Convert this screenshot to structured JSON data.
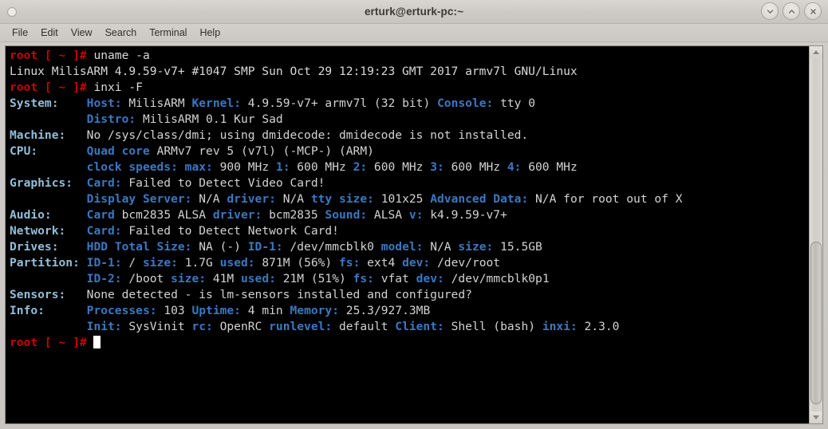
{
  "window": {
    "title": "erturk@erturk-pc:~",
    "icon": "terminal-window-icon",
    "controls": {
      "minimize": "chevron-down-icon",
      "maximize": "chevron-up-icon",
      "close": "close-icon"
    }
  },
  "menubar": {
    "items": [
      {
        "label": "File"
      },
      {
        "label": "Edit"
      },
      {
        "label": "View"
      },
      {
        "label": "Search"
      },
      {
        "label": "Terminal"
      },
      {
        "label": "Help"
      }
    ]
  },
  "scrollbar": {
    "up_icon": "triangle-up-icon",
    "down_icon": "triangle-down-icon",
    "thumb_top_percent": 52,
    "thumb_height_percent": 46
  },
  "terminal": {
    "prompt": "root [ ~ ]# ",
    "commands": [
      "uname -a",
      "inxi -F"
    ],
    "uname_output": "Linux MilisARM 4.9.59-v7+ #1047 SMP Sun Oct 29 12:19:23 GMT 2017 armv7l GNU/Linux",
    "inxi": [
      {
        "section": "System:",
        "lines": [
          [
            {
              "t": "label",
              "v": "Host:"
            },
            {
              "t": "value",
              "v": " MilisARM "
            },
            {
              "t": "label",
              "v": "Kernel:"
            },
            {
              "t": "value",
              "v": " 4.9.59-v7+ armv7l (32 bit) "
            },
            {
              "t": "label",
              "v": "Console:"
            },
            {
              "t": "value",
              "v": " tty 0"
            }
          ],
          [
            {
              "t": "label",
              "v": "Distro:"
            },
            {
              "t": "value",
              "v": " MilisARM 0.1 Kur Sad"
            }
          ]
        ]
      },
      {
        "section": "Machine:",
        "lines": [
          [
            {
              "t": "value",
              "v": "No /sys/class/dmi; using dmidecode: dmidecode is not installed."
            }
          ]
        ]
      },
      {
        "section": "CPU:",
        "lines": [
          [
            {
              "t": "label",
              "v": "Quad core"
            },
            {
              "t": "value",
              "v": " ARMv7 rev 5 (v7l) (-MCP-) (ARM)"
            }
          ],
          [
            {
              "t": "label",
              "v": "clock speeds:"
            },
            {
              "t": "label",
              "v": " max:"
            },
            {
              "t": "value",
              "v": " 900 MHz "
            },
            {
              "t": "label",
              "v": "1:"
            },
            {
              "t": "value",
              "v": " 600 MHz "
            },
            {
              "t": "label",
              "v": "2:"
            },
            {
              "t": "value",
              "v": " 600 MHz "
            },
            {
              "t": "label",
              "v": "3:"
            },
            {
              "t": "value",
              "v": " 600 MHz "
            },
            {
              "t": "label",
              "v": "4:"
            },
            {
              "t": "value",
              "v": " 600 MHz"
            }
          ]
        ]
      },
      {
        "section": "Graphics:",
        "lines": [
          [
            {
              "t": "label",
              "v": "Card:"
            },
            {
              "t": "value",
              "v": " Failed to Detect Video Card!"
            }
          ],
          [
            {
              "t": "label",
              "v": "Display Server:"
            },
            {
              "t": "value",
              "v": " N/A "
            },
            {
              "t": "label",
              "v": "driver:"
            },
            {
              "t": "value",
              "v": " N/A "
            },
            {
              "t": "label",
              "v": "tty size:"
            },
            {
              "t": "value",
              "v": " 101x25 "
            },
            {
              "t": "label",
              "v": "Advanced Data:"
            },
            {
              "t": "value",
              "v": " N/A for root out of X"
            }
          ]
        ]
      },
      {
        "section": "Audio:",
        "lines": [
          [
            {
              "t": "label",
              "v": "Card"
            },
            {
              "t": "value",
              "v": " bcm2835 ALSA "
            },
            {
              "t": "label",
              "v": "driver:"
            },
            {
              "t": "value",
              "v": " bcm2835 "
            },
            {
              "t": "label",
              "v": "Sound:"
            },
            {
              "t": "value",
              "v": " ALSA "
            },
            {
              "t": "label",
              "v": "v:"
            },
            {
              "t": "value",
              "v": " k4.9.59-v7+"
            }
          ]
        ]
      },
      {
        "section": "Network:",
        "lines": [
          [
            {
              "t": "label",
              "v": "Card:"
            },
            {
              "t": "value",
              "v": " Failed to Detect Network Card!"
            }
          ]
        ]
      },
      {
        "section": "Drives:",
        "lines": [
          [
            {
              "t": "label",
              "v": "HDD Total Size:"
            },
            {
              "t": "value",
              "v": " NA (-) "
            },
            {
              "t": "label",
              "v": "ID-1:"
            },
            {
              "t": "value",
              "v": " /dev/mmcblk0 "
            },
            {
              "t": "label",
              "v": "model:"
            },
            {
              "t": "value",
              "v": " N/A "
            },
            {
              "t": "label",
              "v": "size:"
            },
            {
              "t": "value",
              "v": " 15.5GB"
            }
          ]
        ]
      },
      {
        "section": "Partition:",
        "lines": [
          [
            {
              "t": "label",
              "v": "ID-1:"
            },
            {
              "t": "value",
              "v": " / "
            },
            {
              "t": "label",
              "v": "size:"
            },
            {
              "t": "value",
              "v": " 1.7G "
            },
            {
              "t": "label",
              "v": "used:"
            },
            {
              "t": "value",
              "v": " 871M (56%) "
            },
            {
              "t": "label",
              "v": "fs:"
            },
            {
              "t": "value",
              "v": " ext4 "
            },
            {
              "t": "label",
              "v": "dev:"
            },
            {
              "t": "value",
              "v": " /dev/root"
            }
          ],
          [
            {
              "t": "label",
              "v": "ID-2:"
            },
            {
              "t": "value",
              "v": " /boot "
            },
            {
              "t": "label",
              "v": "size:"
            },
            {
              "t": "value",
              "v": " 41M "
            },
            {
              "t": "label",
              "v": "used:"
            },
            {
              "t": "value",
              "v": " 21M (51%) "
            },
            {
              "t": "label",
              "v": "fs:"
            },
            {
              "t": "value",
              "v": " vfat "
            },
            {
              "t": "label",
              "v": "dev:"
            },
            {
              "t": "value",
              "v": " /dev/mmcblk0p1"
            }
          ]
        ]
      },
      {
        "section": "Sensors:",
        "lines": [
          [
            {
              "t": "value",
              "v": "None detected - is lm-sensors installed and configured?"
            }
          ]
        ]
      },
      {
        "section": "Info:",
        "lines": [
          [
            {
              "t": "label",
              "v": "Processes:"
            },
            {
              "t": "value",
              "v": " 103 "
            },
            {
              "t": "label",
              "v": "Uptime:"
            },
            {
              "t": "value",
              "v": " 4 min "
            },
            {
              "t": "label",
              "v": "Memory:"
            },
            {
              "t": "value",
              "v": " 25.3/927.3MB"
            }
          ],
          [
            {
              "t": "label",
              "v": "Init:"
            },
            {
              "t": "value",
              "v": " SysVinit "
            },
            {
              "t": "label",
              "v": "rc:"
            },
            {
              "t": "value",
              "v": " OpenRC "
            },
            {
              "t": "label",
              "v": "runlevel:"
            },
            {
              "t": "value",
              "v": " default "
            },
            {
              "t": "label",
              "v": "Client:"
            },
            {
              "t": "value",
              "v": " Shell (bash) "
            },
            {
              "t": "label",
              "v": "inxi:"
            },
            {
              "t": "value",
              "v": " 2.3.0"
            }
          ]
        ]
      }
    ],
    "colors": {
      "prompt": "#cc0000",
      "section": "#93bdd8",
      "label": "#3a78c2",
      "value": "#d3d3d3",
      "background": "#000000"
    }
  }
}
